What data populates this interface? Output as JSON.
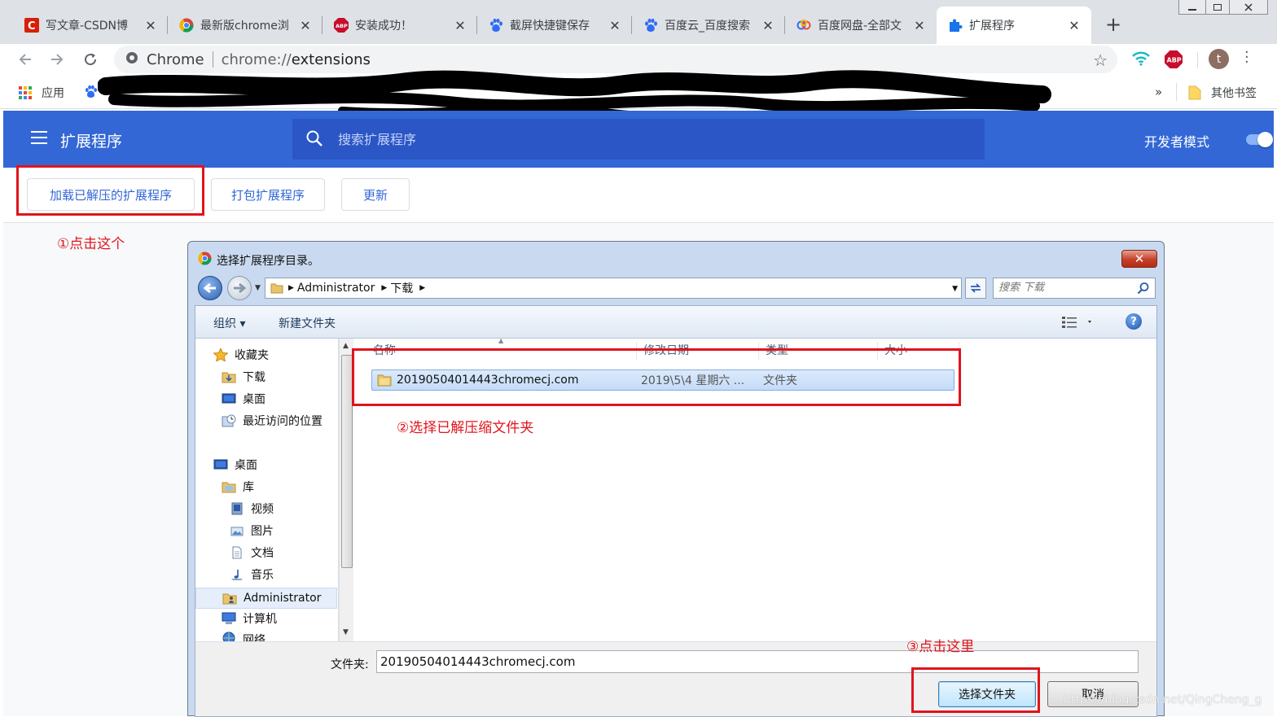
{
  "browser": {
    "tabs": [
      {
        "title": "写文章-CSDN博",
        "icon": "csdn-icon"
      },
      {
        "title": "最新版chrome浏",
        "icon": "chrome-icon"
      },
      {
        "title": "安装成功！",
        "icon": "abp-icon"
      },
      {
        "title": "截屏快捷键保存",
        "icon": "baidu-paw-icon"
      },
      {
        "title": "百度云_百度搜索",
        "icon": "baidu-paw-icon"
      },
      {
        "title": "百度网盘-全部文",
        "icon": "baidu-cloud-icon"
      },
      {
        "title": "扩展程序",
        "icon": "puzzle-icon",
        "active": true
      }
    ],
    "close_glyph": "✕",
    "newtab_glyph": "+",
    "omnibox": {
      "chip": "Chrome",
      "scheme": "chrome://",
      "path": "extensions"
    },
    "abp_label": "ABP",
    "avatar_letter": "t",
    "bookmarks": {
      "apps": "应用",
      "overflow": "»",
      "other": "其他书签"
    }
  },
  "extensions_page": {
    "title": "扩展程序",
    "search_placeholder": "搜索扩展程序",
    "developer_mode_label": "开发者模式",
    "developer_mode_on": true,
    "buttons": {
      "load_unpacked": "加载已解压的扩展程序",
      "pack": "打包扩展程序",
      "update": "更新"
    },
    "accent": "#3367d6"
  },
  "annotations": {
    "step1": "①点击这个",
    "step2": "②选择已解压缩文件夹",
    "step3": "③点击这里",
    "color": "#e0141c"
  },
  "dialog": {
    "title": "选择扩展程序目录。",
    "close_glyph": "✕",
    "path": [
      "Administrator",
      "下载"
    ],
    "search_placeholder": "搜索 下载",
    "toolbar": {
      "organize": "组织 ▾",
      "new_folder": "新建文件夹",
      "help": "?"
    },
    "nav": {
      "favorites": "收藏夹",
      "downloads": "下载",
      "desktop_fav": "桌面",
      "recent": "最近访问的位置",
      "desktop": "桌面",
      "libraries": "库",
      "videos": "视频",
      "pictures": "图片",
      "documents": "文档",
      "music": "音乐",
      "administrator": "Administrator",
      "computer": "计算机",
      "network": "网络"
    },
    "columns": [
      "名称",
      "修改日期",
      "类型",
      "大小"
    ],
    "files": [
      {
        "name": "20190504014443chromecj.com",
        "date": "2019\\5\\4 星期六 ...",
        "type": "文件夹"
      }
    ],
    "folder_label": "文件夹:",
    "folder_value": "20190504014443chromecj.com",
    "ok_label": "选择文件夹",
    "cancel_label": "取消"
  },
  "watermark": "https://blog.csdn.net/QingCheng_g"
}
